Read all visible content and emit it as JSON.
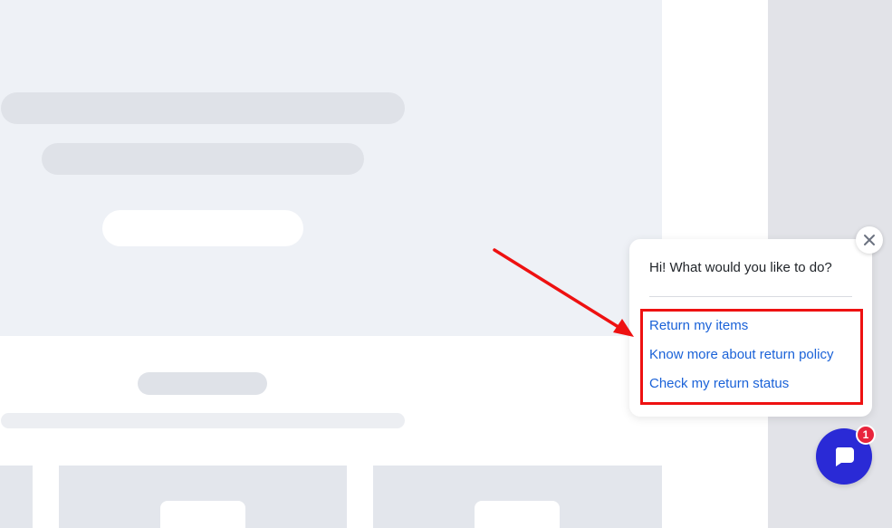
{
  "chat_widget": {
    "greeting": "Hi! What would you like to do?",
    "options": [
      {
        "label": "Return my items"
      },
      {
        "label": "Know more about return policy"
      },
      {
        "label": "Check my return status"
      }
    ],
    "close_icon": "close-icon",
    "launcher_icon": "chat-bubble-icon",
    "unread_count": "1"
  },
  "colors": {
    "link": "#1a62d8",
    "launcher": "#2a2ad6",
    "badge": "#e8243c",
    "highlight": "#ee1111"
  }
}
